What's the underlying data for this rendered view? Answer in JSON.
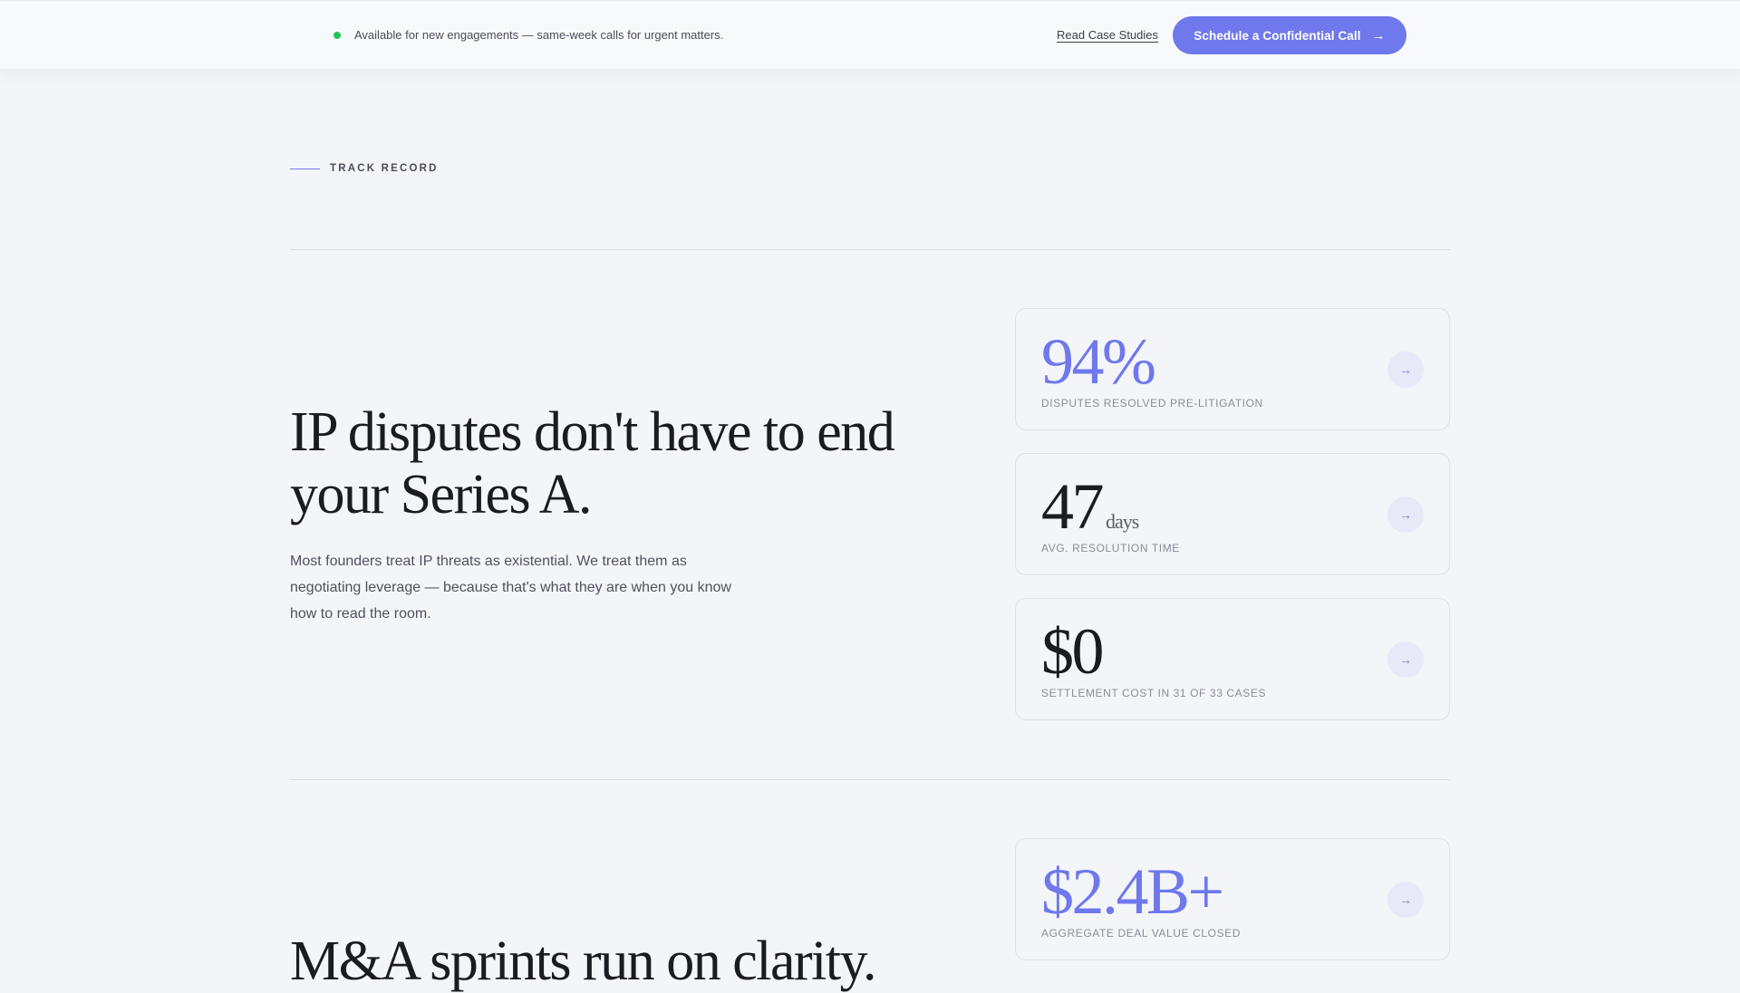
{
  "topbar": {
    "availability": "Available for new engagements — same-week calls for urgent matters.",
    "read_link": "Read Case Studies",
    "cta_label": "Schedule a Confidential Call",
    "cta_arrow": "→",
    "status_color": "#22c55e",
    "accent_color": "#6f78ec"
  },
  "section": {
    "eyebrow": "TRACK RECORD"
  },
  "practices": [
    {
      "headline": "IP disputes don't have to end your Series A.",
      "body": "Most founders treat IP threats as existential. We treat them as negotiating leverage — because that's what they are when you know how to read the room.",
      "stats": [
        {
          "value": "94%",
          "unit": "",
          "label": "DISPUTES RESOLVED PRE-LITIGATION",
          "style": "accent",
          "arrow": "→"
        },
        {
          "value": "47",
          "unit": "days",
          "label": "AVG. RESOLUTION TIME",
          "style": "dark",
          "arrow": "→"
        },
        {
          "value": "$0",
          "unit": "",
          "label": "SETTLEMENT COST IN 31 OF 33 CASES",
          "style": "dark",
          "arrow": "→"
        }
      ]
    },
    {
      "headline": "M&A sprints run on clarity.",
      "body": "",
      "stats": [
        {
          "value": "$2.4B+",
          "unit": "",
          "label": "AGGREGATE DEAL VALUE CLOSED",
          "style": "accent",
          "arrow": "→"
        }
      ]
    }
  ]
}
